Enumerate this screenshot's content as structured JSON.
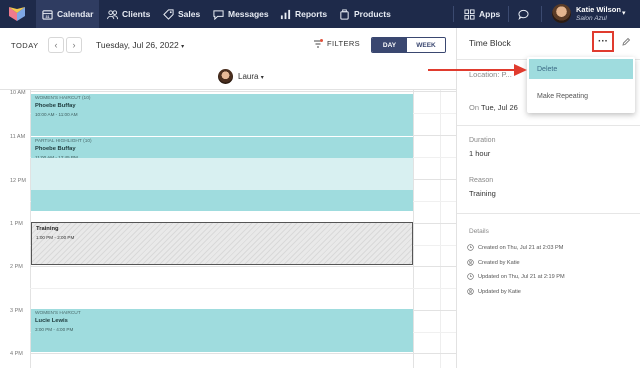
{
  "nav": {
    "items": [
      {
        "label": "Calendar",
        "icon": "calendar-icon"
      },
      {
        "label": "Clients",
        "icon": "clients-icon"
      },
      {
        "label": "Sales",
        "icon": "sales-tag-icon"
      },
      {
        "label": "Messages",
        "icon": "messages-icon"
      },
      {
        "label": "Reports",
        "icon": "reports-icon"
      },
      {
        "label": "Products",
        "icon": "products-icon"
      }
    ],
    "apps_label": "Apps",
    "user": {
      "name": "Katie Wilson",
      "location": "Salon Azul"
    }
  },
  "toolbar": {
    "today_label": "TODAY",
    "date": "Tuesday, Jul 26, 2022",
    "filters_label": "FILTERS",
    "view_day": "DAY",
    "view_week": "WEEK"
  },
  "staff": {
    "name": "Laura"
  },
  "times": [
    "10 AM",
    "11 AM",
    "12 PM",
    "1 PM",
    "2 PM",
    "3 PM",
    "4 PM"
  ],
  "appointments": [
    {
      "service": "WOMEN'S HAIRCUT",
      "badge": "(10)",
      "client": "Phoebe Buffay",
      "time": "10:00 AM - 11:00 AM"
    },
    {
      "service": "PARTIAL HIGHLIGHT",
      "badge": "(10)",
      "client": "Phoebe Buffay",
      "time": "11:00 AM - 12:45 PM"
    },
    {
      "service": "WOMEN'S HAIRCUT",
      "badge": "",
      "client": "Lucie Lewis",
      "time": "3:00 PM - 4:00 PM"
    }
  ],
  "block": {
    "title": "Training",
    "time": "1:00 PM - 2:00 PM"
  },
  "panel": {
    "title": "Time Block",
    "location_label": "Location:",
    "location_value": "P...",
    "on_label": "On",
    "on_value": "Tue, Jul 26",
    "duration_label": "Duration",
    "duration_value": "1 hour",
    "reason_label": "Reason",
    "reason_value": "Training",
    "details_label": "Details",
    "details": [
      "Created on Thu, Jul 21 at 2:03 PM",
      "Created by Katie",
      "Updated on Thu, Jul 21 at 2:19 PM",
      "Updated by Katie"
    ]
  },
  "menu": {
    "items": [
      "Delete",
      "Make Repeating"
    ],
    "highlighted": "Delete"
  },
  "colors": {
    "nav_bg": "#1e2a4a",
    "appointment": "#9fdcde",
    "annotation_red": "#e03b2e"
  }
}
